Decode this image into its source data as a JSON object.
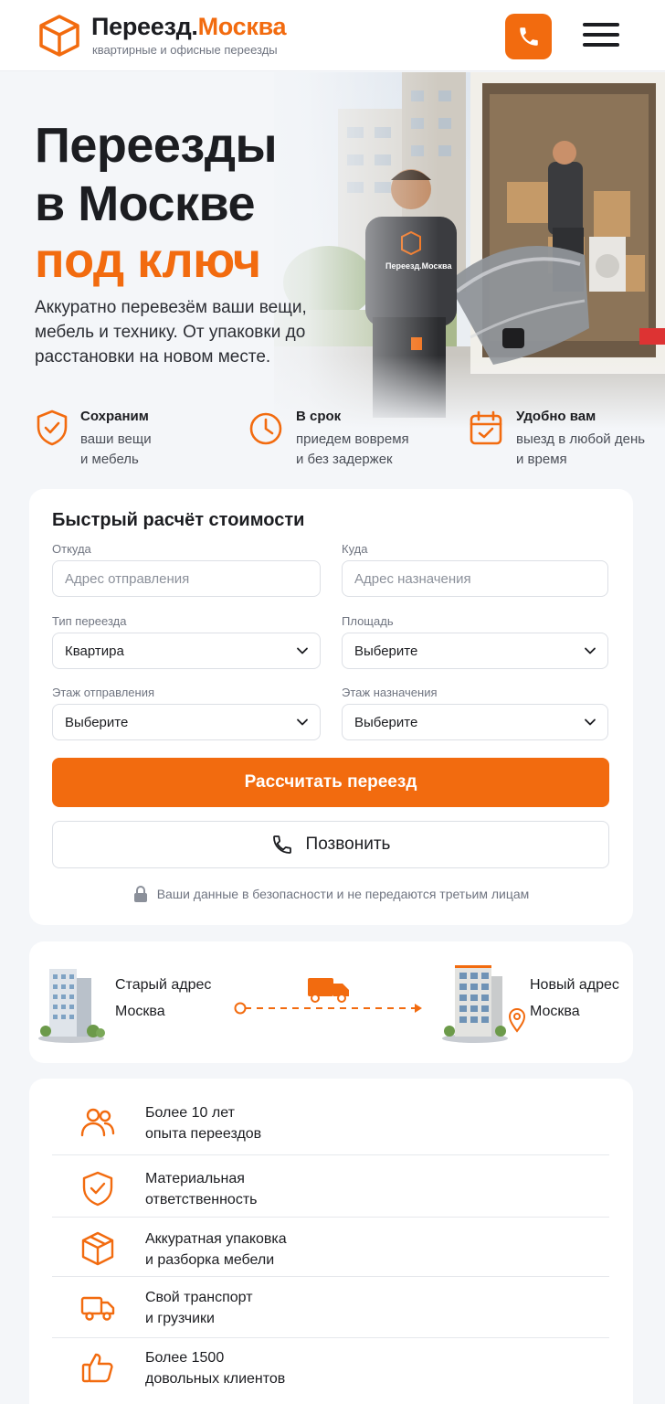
{
  "header": {
    "logo_part1": "Переезд.",
    "logo_part2": "Москва",
    "tagline": "квартирные и офисные переезды"
  },
  "hero": {
    "title_line1": "Переезды",
    "title_line2": "в Москве",
    "title_accent": "под ключ",
    "description": "Аккуратно перевезём ваши вещи, мебель и технику. От упаковки до расстановки на новом месте.",
    "photo_logo": "Переезд.Москва"
  },
  "benefits": [
    {
      "title": "Сохраним",
      "line1": "ваши вещи",
      "line2": "и мебель",
      "icon": "shield-check-icon"
    },
    {
      "title": "В срок",
      "line1": "приедем вовремя",
      "line2": "и без задержек",
      "icon": "clock-icon"
    },
    {
      "title": "Удобно вам",
      "line1": "выезд в любой день",
      "line2": "и время",
      "icon": "calendar-check-icon"
    }
  ],
  "calculator": {
    "title": "Быстрый расчёт стоимости",
    "from_label": "Откуда",
    "from_placeholder": "Адрес отправления",
    "to_label": "Куда",
    "to_placeholder": "Адрес назначения",
    "type_label": "Тип переезда",
    "type_value": "Квартира",
    "area_label": "Площадь",
    "area_value": "Выберите",
    "floor_from_label": "Этаж отправления",
    "floor_from_value": "Выберите",
    "floor_to_label": "Этаж назначения",
    "floor_to_value": "Выберите",
    "calc_button": "Рассчитать переезд",
    "call_button": "Позвонить",
    "secure_note": "Ваши данные в безопасности и не передаются третьим лицам"
  },
  "route": {
    "old_label": "Старый адрес",
    "old_city": "Москва",
    "new_label": "Новый адрес",
    "new_city": "Москва"
  },
  "features": [
    {
      "text": "Более 10 лет\nопыта переездов",
      "icon": "users-icon"
    },
    {
      "text": "Материальная\nответственность",
      "icon": "shield-check-icon"
    },
    {
      "text": "Аккуратная упаковка\nи разборка мебели",
      "icon": "box-icon"
    },
    {
      "text": "Свой транспорт\nи грузчики",
      "icon": "truck-icon"
    },
    {
      "text": "Более 1500\nдовольных клиентов",
      "icon": "thumbs-up-icon"
    }
  ],
  "colors": {
    "accent": "#f26b0f",
    "text": "#1c1d21",
    "muted": "#6f7480",
    "background": "#f4f6f9"
  }
}
